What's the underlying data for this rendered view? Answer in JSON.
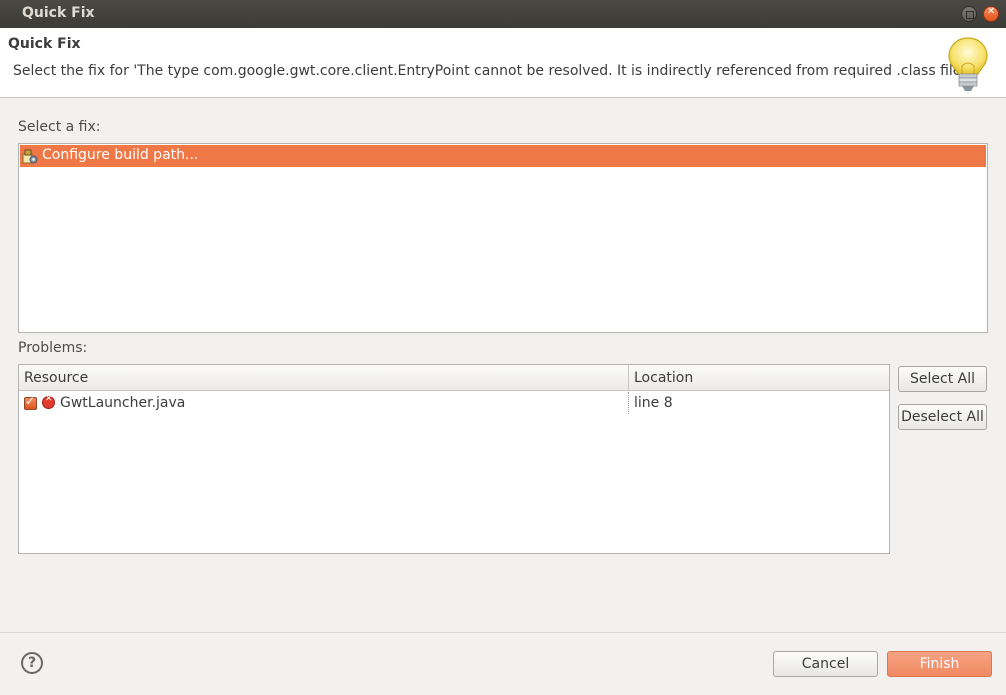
{
  "window": {
    "title": "Quick Fix"
  },
  "header": {
    "title": "Quick Fix",
    "message": "Select the fix for 'The type com.google.gwt.core.client.EntryPoint cannot be resolved. It is indirectly referenced from required .class files'."
  },
  "fixes": {
    "label": "Select a fix:",
    "items": [
      {
        "label": "Configure build path...",
        "icon": "build-path-icon",
        "selected": true
      }
    ]
  },
  "problems": {
    "label": "Problems:",
    "columns": [
      "Resource",
      "Location"
    ],
    "rows": [
      {
        "checked": true,
        "icon": "error-icon",
        "resource": "GwtLauncher.java",
        "location": "line 8"
      }
    ],
    "select_all": "Select All",
    "deselect_all": "Deselect All"
  },
  "footer": {
    "help_icon": "help-icon",
    "cancel": "Cancel",
    "finish": "Finish"
  },
  "colors": {
    "selection": "#f07746",
    "primary_button": "#f08a62",
    "titlebar": "#3c3b37"
  }
}
